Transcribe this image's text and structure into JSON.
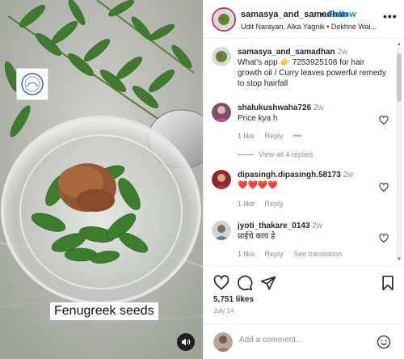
{
  "media": {
    "overlay_caption": "Fenugreek seeds",
    "logo_text": "samasya samadhan"
  },
  "header": {
    "username": "samasya_and_samadhan",
    "separator": "•",
    "follow_label": "Follow",
    "audio": "Udit Narayan, Alka Yagnik • Dekhne Wal...",
    "more": "•••"
  },
  "caption": {
    "username": "samasya_and_samadhan",
    "time": "2w",
    "text": "What's app 👉 7253925108 for hair growth oil / Curry leaves powerful remedy to stop hairfall"
  },
  "comments": [
    {
      "username": "shalukushwaha726",
      "time": "2w",
      "text": "Price kya h",
      "likes": "1 like",
      "reply": "Reply",
      "more": "•••",
      "view_replies": "View all 4 replies"
    },
    {
      "username": "dipasingh.dipasingh.58173",
      "time": "2w",
      "text": "❤️❤️❤️❤️",
      "likes": "1 like",
      "reply": "Reply"
    },
    {
      "username": "jyoti_thakare_0143",
      "time": "2w",
      "text": "प्राईचे काय हे",
      "likes": "1 like",
      "reply": "Reply",
      "translate": "See translation"
    }
  ],
  "stats": {
    "likes": "5,751 likes",
    "date": "July 14"
  },
  "add_comment": {
    "placeholder": "Add a comment..."
  },
  "colors": {
    "accent": "#0095f6",
    "story_ring": "#d62976",
    "heart_red": "#ed4956"
  }
}
